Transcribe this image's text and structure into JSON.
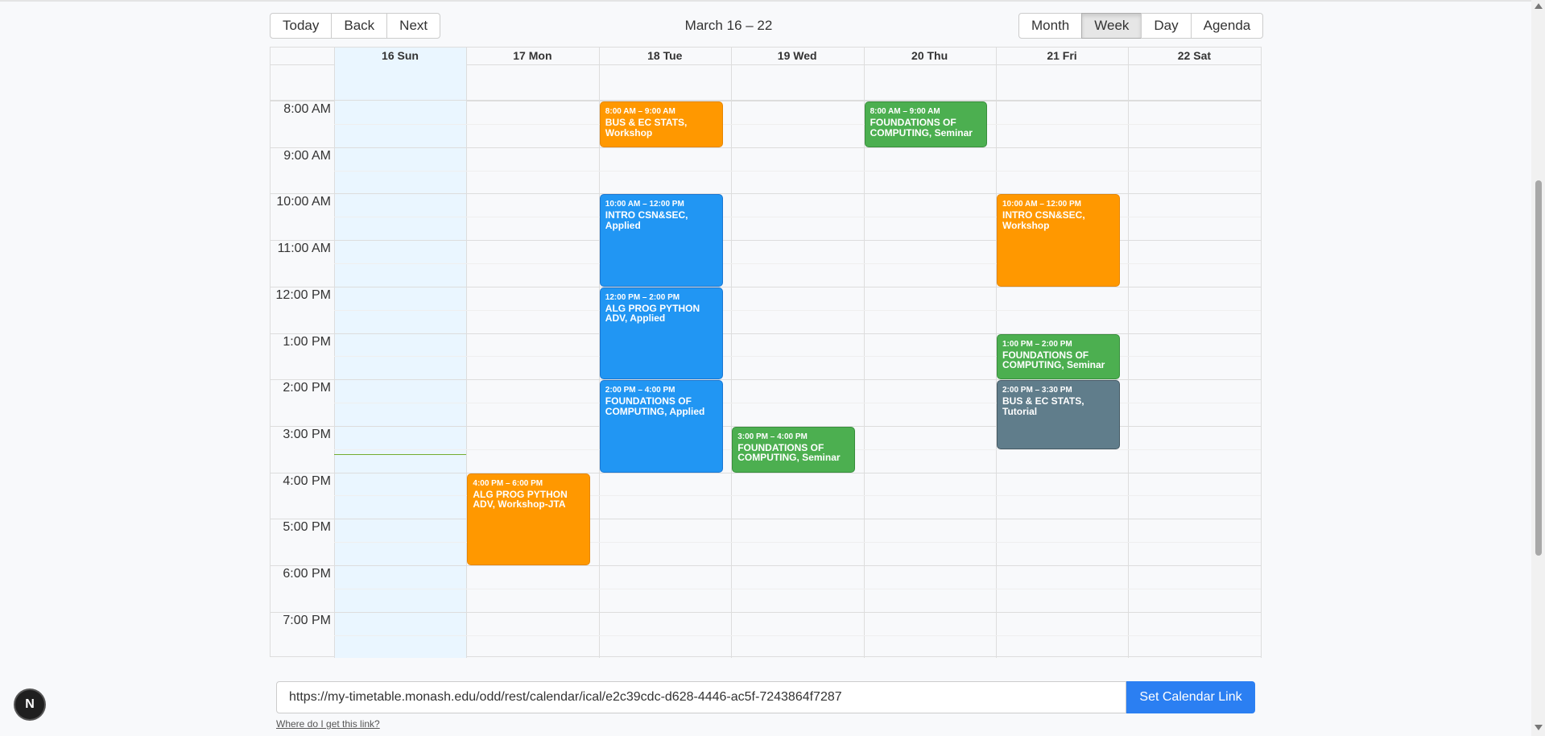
{
  "toolbar": {
    "nav": [
      "Today",
      "Back",
      "Next"
    ],
    "label": "March 16 – 22",
    "views": [
      "Month",
      "Week",
      "Day",
      "Agenda"
    ],
    "active_view": "Week"
  },
  "days": [
    "16 Sun",
    "17 Mon",
    "18 Tue",
    "19 Wed",
    "20 Thu",
    "21 Fri",
    "22 Sat"
  ],
  "today_index": 0,
  "times": [
    "8:00 AM",
    "9:00 AM",
    "10:00 AM",
    "11:00 AM",
    "12:00 PM",
    "1:00 PM",
    "2:00 PM",
    "3:00 PM",
    "4:00 PM",
    "5:00 PM",
    "6:00 PM",
    "7:00 PM"
  ],
  "events": [
    {
      "day": 2,
      "start": 8,
      "end": 9,
      "time": "8:00 AM – 9:00 AM",
      "title": "BUS & EC STATS, Workshop",
      "color": "orange"
    },
    {
      "day": 4,
      "start": 8,
      "end": 9,
      "time": "8:00 AM – 9:00 AM",
      "title": "FOUNDATIONS OF COMPUTING, Seminar",
      "color": "green"
    },
    {
      "day": 2,
      "start": 10,
      "end": 12,
      "time": "10:00 AM – 12:00 PM",
      "title": "INTRO CSN&SEC, Applied",
      "color": "blue"
    },
    {
      "day": 5,
      "start": 10,
      "end": 12,
      "time": "10:00 AM – 12:00 PM",
      "title": "INTRO CSN&SEC, Workshop",
      "color": "orange"
    },
    {
      "day": 2,
      "start": 12,
      "end": 14,
      "time": "12:00 PM – 2:00 PM",
      "title": "ALG PROG PYTHON ADV, Applied",
      "color": "blue"
    },
    {
      "day": 5,
      "start": 13,
      "end": 14,
      "time": "1:00 PM – 2:00 PM",
      "title": "FOUNDATIONS OF COMPUTING, Seminar",
      "color": "green"
    },
    {
      "day": 2,
      "start": 14,
      "end": 16,
      "time": "2:00 PM – 4:00 PM",
      "title": "FOUNDATIONS OF COMPUTING, Applied",
      "color": "blue"
    },
    {
      "day": 5,
      "start": 14,
      "end": 15.5,
      "time": "2:00 PM – 3:30 PM",
      "title": "BUS & EC STATS, Tutorial",
      "color": "slate"
    },
    {
      "day": 3,
      "start": 15,
      "end": 16,
      "time": "3:00 PM – 4:00 PM",
      "title": "FOUNDATIONS OF COMPUTING, Seminar",
      "color": "green"
    },
    {
      "day": 1,
      "start": 16,
      "end": 18,
      "time": "4:00 PM – 6:00 PM",
      "title": "ALG PROG PYTHON ADV, Workshop-JTA",
      "color": "orange"
    }
  ],
  "now_hour": 15.6,
  "link": {
    "value": "https://my-timetable.monash.edu/odd/rest/calendar/ical/e2c39cdc-d628-4446-ac5f-7243864f7287",
    "button": "Set Calendar Link",
    "help": "Where do I get this link?"
  },
  "badge": "N",
  "colors": {
    "orange": "#ff9800",
    "blue": "#2196f3",
    "green": "#4caf50",
    "slate": "#607d8b",
    "today": "#eaf6ff",
    "accent": "#2b7ff2"
  }
}
